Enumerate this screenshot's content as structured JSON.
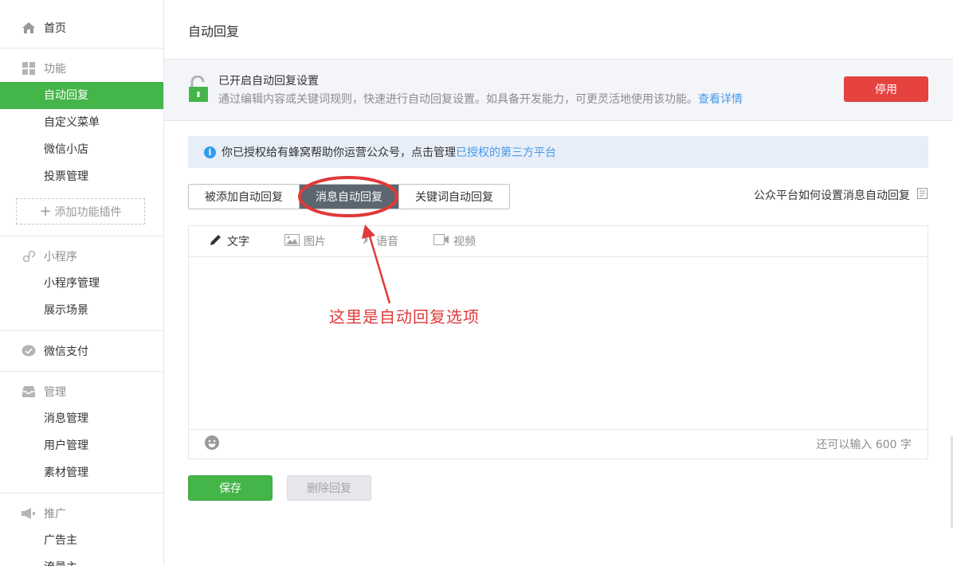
{
  "sidebar": {
    "home": {
      "label": "首页",
      "icon": "home-icon"
    },
    "groups": [
      {
        "title": "功能",
        "icon": "grid-icon",
        "items": [
          "自动回复",
          "自定义菜单",
          "微信小店",
          "投票管理"
        ],
        "add_plugin": "添加功能插件"
      },
      {
        "title": "小程序",
        "icon": "link-icon",
        "items": [
          "小程序管理",
          "展示场景"
        ]
      },
      {
        "title": "微信支付",
        "icon": "wechat-pay-icon",
        "items": []
      },
      {
        "title": "管理",
        "icon": "inbox-icon",
        "items": [
          "消息管理",
          "用户管理",
          "素材管理"
        ]
      },
      {
        "title": "推广",
        "icon": "megaphone-icon",
        "items": [
          "广告主",
          "流量主"
        ]
      }
    ],
    "active_item": "自动回复"
  },
  "main": {
    "page_title": "自动回复",
    "status": {
      "title": "已开启自动回复设置",
      "description": "通过编辑内容或关键词规则，快速进行自动回复设置。如具备开发能力，可更灵活地使用该功能。",
      "details_link": "查看详情",
      "disable_button": "停用"
    },
    "info_bar": {
      "text": "你已授权给有蜂窝帮助你运营公众号，点击管理",
      "link": "已授权的第三方平台"
    },
    "tabs": [
      {
        "label": "被添加自动回复",
        "active": false
      },
      {
        "label": "消息自动回复",
        "active": true
      },
      {
        "label": "关键词自动回复",
        "active": false
      }
    ],
    "help_link": "公众平台如何设置消息自动回复",
    "editor": {
      "tools": [
        {
          "label": "文字",
          "icon": "pencil-icon",
          "active": true
        },
        {
          "label": "图片",
          "icon": "image-icon",
          "active": false
        },
        {
          "label": "语音",
          "icon": "mic-icon",
          "active": false
        },
        {
          "label": "视频",
          "icon": "video-icon",
          "active": false
        }
      ],
      "char_count": "还可以输入 600 字"
    },
    "save_button": "保存",
    "delete_button": "删除回复"
  },
  "annotation": {
    "text": "这里是自动回复选项",
    "color": "#e03a3a"
  },
  "colors": {
    "accent_green": "#44b549",
    "danger_red": "#e64340",
    "link_blue": "#459ae9",
    "tab_active": "#5b6670"
  }
}
